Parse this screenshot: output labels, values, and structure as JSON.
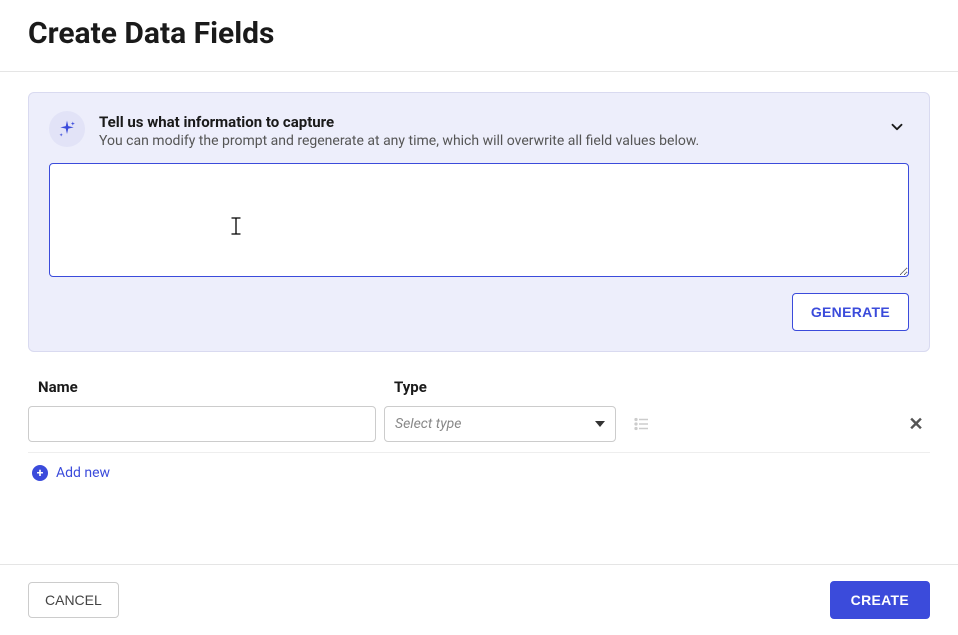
{
  "header": {
    "title": "Create Data Fields"
  },
  "prompt_panel": {
    "title": "Tell us what information to capture",
    "subtitle": "You can modify the prompt and regenerate at any time, which will overwrite all field values below.",
    "textarea_value": "",
    "generate_label": "GENERATE"
  },
  "fields": {
    "name_header": "Name",
    "type_header": "Type",
    "rows": [
      {
        "name_value": "",
        "type_placeholder": "Select type"
      }
    ],
    "add_new_label": "Add new"
  },
  "footer": {
    "cancel_label": "CANCEL",
    "create_label": "CREATE"
  }
}
